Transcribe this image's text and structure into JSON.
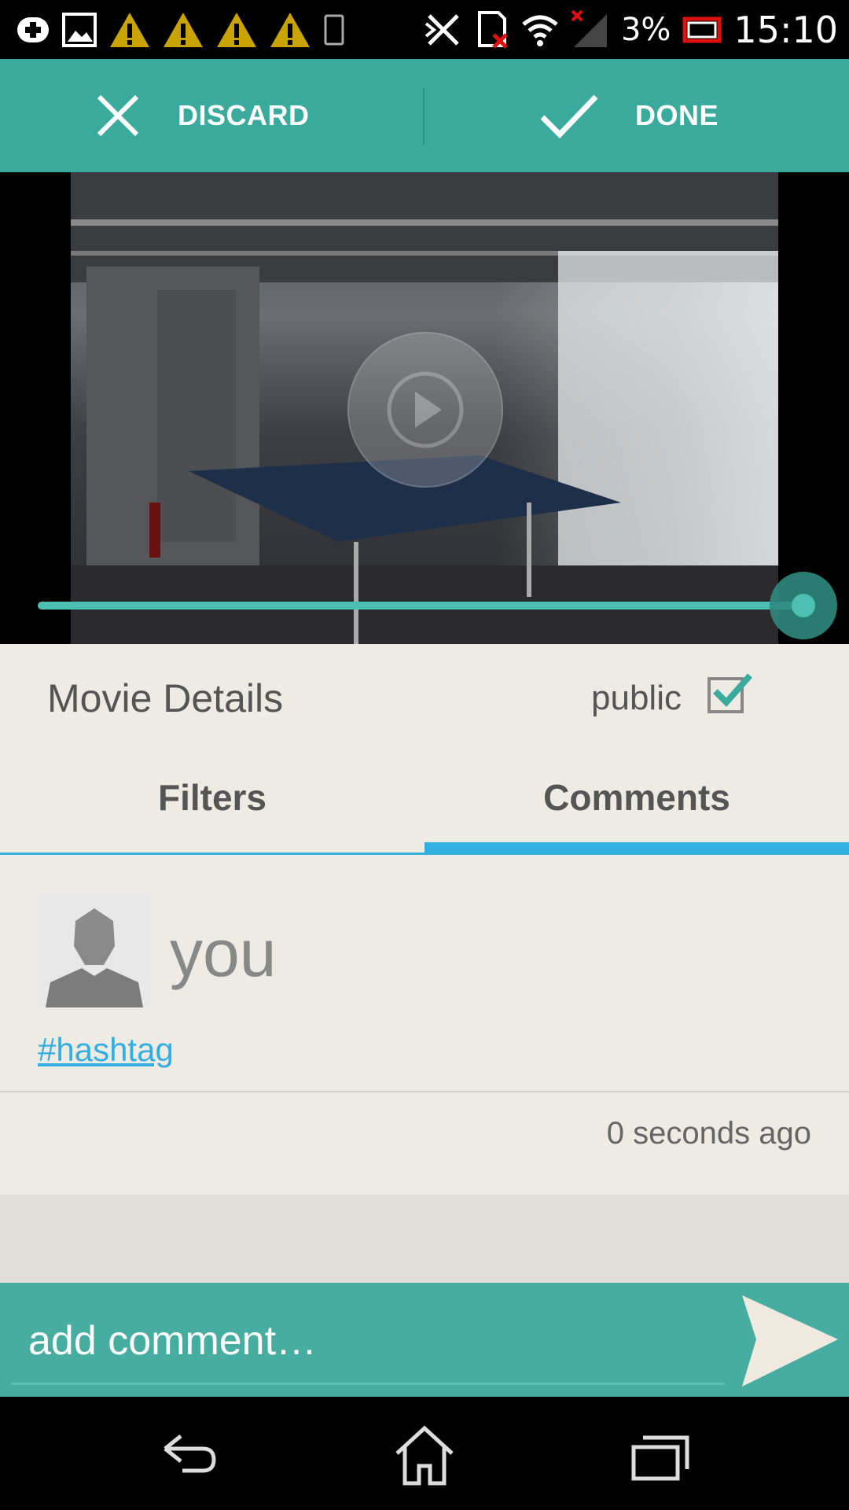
{
  "status_bar": {
    "battery_percent": "3%",
    "time": "15:10",
    "icons": [
      "notification-plus-icon",
      "gallery-icon",
      "warning-icon",
      "warning-icon",
      "warning-icon",
      "warning-icon",
      "phone-icon",
      "nfc-off-icon",
      "sd-card-error-icon",
      "wifi-icon",
      "no-signal-icon",
      "battery-low-icon"
    ]
  },
  "action_bar": {
    "discard_label": "DISCARD",
    "done_label": "DONE"
  },
  "video": {
    "progress": 0.99
  },
  "details": {
    "title": "Movie Details",
    "public_label": "public",
    "public_checked": true
  },
  "tabs": [
    {
      "label": "Filters",
      "active": false
    },
    {
      "label": "Comments",
      "active": true
    }
  ],
  "comment": {
    "author": "you",
    "text": "#hashtag",
    "timestamp": "0 seconds ago"
  },
  "composer": {
    "placeholder": "add comment…"
  },
  "colors": {
    "accent": "#3aaa9c",
    "tab_indicator": "#33aee0",
    "panel_bg": "#eeeae4"
  }
}
